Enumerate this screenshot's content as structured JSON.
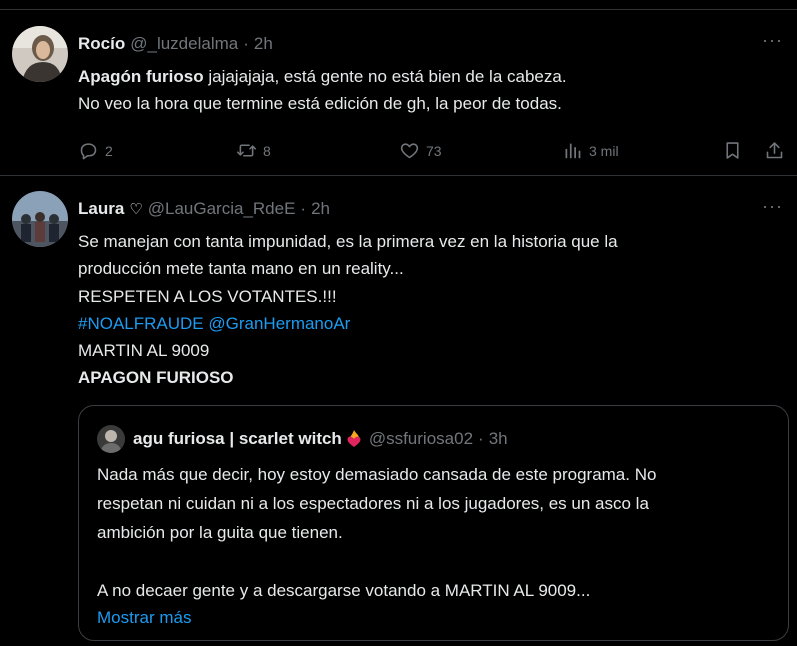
{
  "tweets": [
    {
      "author_name": "Rocío",
      "handle": "@_luzdelalma",
      "separator": "·",
      "time": "2h",
      "more": "···",
      "body_bold": "Apagón furioso",
      "body_line1_rest": " jajajajaja, está gente no está bien de la cabeza.",
      "body_line2": "No veo la hora que termine está edición de gh, la peor de todas.",
      "actions": {
        "replies": "2",
        "retweets": "8",
        "likes": "73",
        "views": "3 mil"
      }
    },
    {
      "author_name": "Laura",
      "name_icon": "heart-outline-icon",
      "name_badge": "♡",
      "handle": "@LauGarcia_RdeE",
      "separator": "·",
      "time": "2h",
      "more": "···",
      "lines": [
        "Se manejan con tanta  impunidad, es la primera vez en la historia que la",
        "producción mete tanta mano en un reality...",
        "RESPETEN A LOS VOTANTES.!!!"
      ],
      "hashtag": "#NOALFRAUDE",
      "mention": "@GranHermanoAr",
      "line_martin": "MARTIN AL 9009",
      "line_bold": "APAGON FURIOSO",
      "quote": {
        "author_name": "agu furiosa | scarlet witch",
        "name_icon": "heart-on-fire-emoji",
        "handle": "@ssfuriosa02",
        "separator": "·",
        "time": "3h",
        "lines": [
          "Nada más que decir, hoy estoy demasiado cansada de este programa. No",
          "respetan ni cuidan ni a los espectadores ni a los jugadores, es un asco la",
          "ambición por la guita que tienen."
        ],
        "line_after": "A no decaer gente y a descargarse votando a MARTIN AL 9009...",
        "show_more": "Mostrar más"
      }
    }
  ],
  "colors": {
    "background": "#000000",
    "text": "#e7e9ea",
    "secondary": "#71767b",
    "link": "#1d9bf0",
    "border": "#2f3336"
  }
}
